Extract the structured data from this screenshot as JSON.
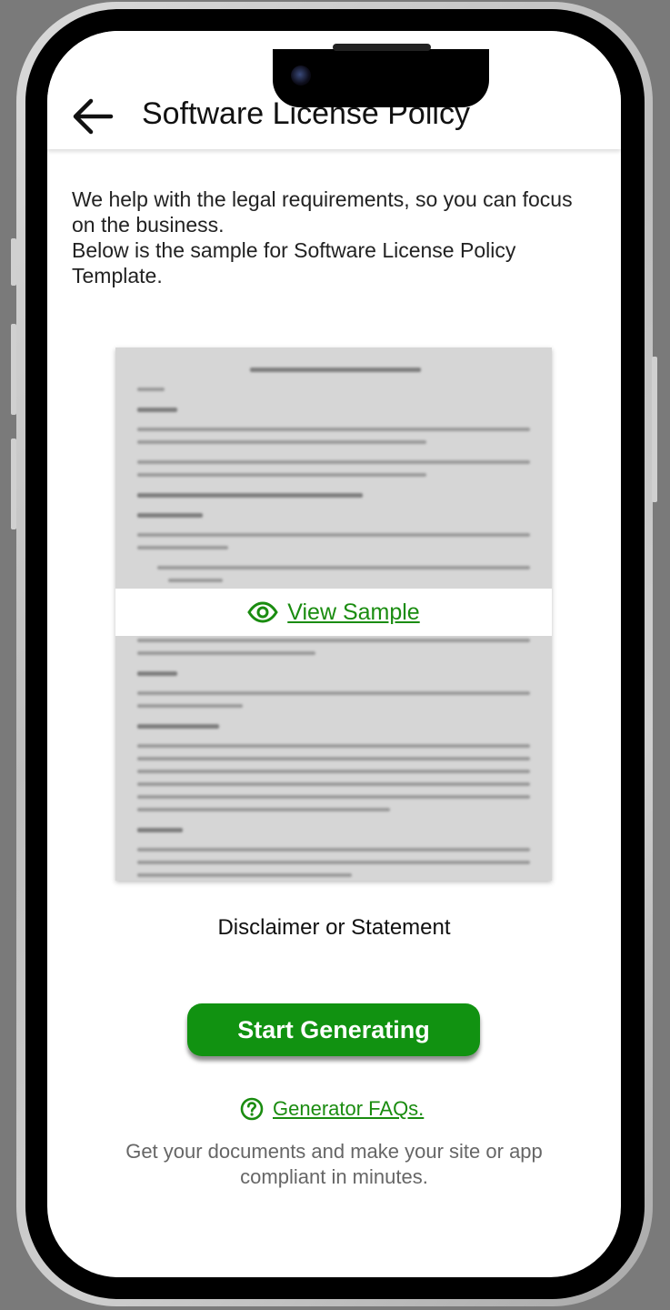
{
  "header": {
    "title": "Software License Policy",
    "back_icon": "arrow-left-icon"
  },
  "intro": {
    "line1": "We help with the legal requirements, so you can focus on the business.",
    "line2": "Below is the sample for Software License Policy Template."
  },
  "sample": {
    "view_label": "View Sample",
    "view_icon": "eye-icon"
  },
  "disclaimer": "Disclaimer or Statement",
  "start_button": "Start Generating",
  "faq": {
    "label": "Generator FAQs.",
    "icon": "question-circle-icon"
  },
  "footer": "Get your documents and make your site or app compliant in minutes.",
  "colors": {
    "accent": "#119211",
    "link": "#1a8c10"
  }
}
